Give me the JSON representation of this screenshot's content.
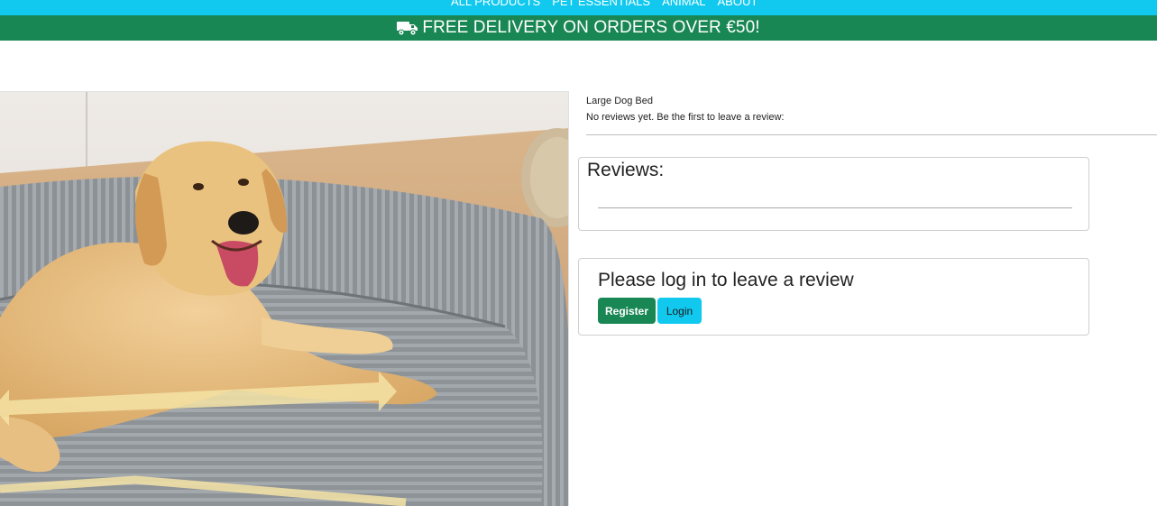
{
  "nav": {
    "items": [
      {
        "label": "ALL PRODUCTS"
      },
      {
        "label": "PET ESSENTIALS"
      },
      {
        "label": "ANIMAL"
      },
      {
        "label": "ABOUT"
      }
    ]
  },
  "promo": {
    "icon": "truck-icon",
    "text": "FREE DELIVERY ON ORDERS OVER €50!"
  },
  "product": {
    "name": "Large Dog Bed",
    "review_prompt": "No reviews yet. Be the first to leave a review:",
    "image": "golden-retriever-on-grey-dog-bed"
  },
  "reviews": {
    "title": "Reviews:"
  },
  "login_card": {
    "title": "Please log in to leave a review",
    "register_label": "Register",
    "login_label": "Login"
  },
  "colors": {
    "nav_bg": "#11c9ef",
    "promo_bg": "#198754",
    "register_bg": "#198754",
    "login_bg": "#11c9ef"
  }
}
